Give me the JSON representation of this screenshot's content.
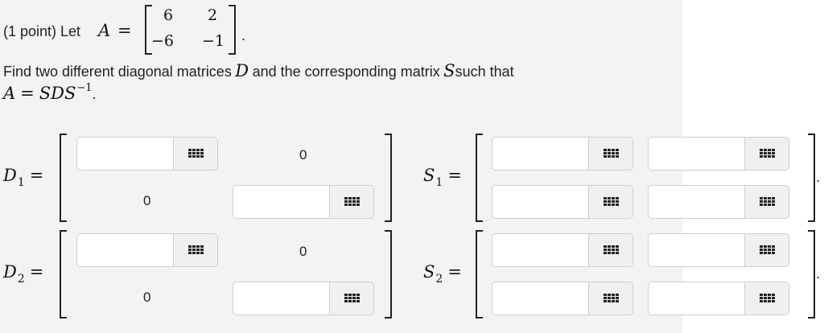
{
  "problem": {
    "points_label": "(1 point) Let",
    "matrix_name": "A",
    "matrix_A": [
      [
        "6",
        "2"
      ],
      [
        "−6",
        "−1"
      ]
    ],
    "find_text_pre": "Find two different diagonal matrices",
    "find_var_D": "D",
    "find_text_mid": "and the corresponding matrix",
    "find_var_S": "S",
    "find_text_post": "such that",
    "relation_lhs": "A",
    "relation_rhs": "SDS",
    "relation_exp": "−1",
    "period": "."
  },
  "answers": {
    "equals": "=",
    "zero": "0",
    "input_placeholder": "",
    "D1": {
      "name": "D",
      "sub": "1"
    },
    "S1": {
      "name": "S",
      "sub": "1"
    },
    "D2": {
      "name": "D",
      "sub": "2"
    },
    "S2": {
      "name": "S",
      "sub": "2"
    },
    "trailing_dot": "."
  },
  "icons": {
    "matrix_button": "grid-icon"
  },
  "colors": {
    "panel": "#f3f3f3",
    "page": "#ffffff",
    "button": "#f0f0f0"
  }
}
